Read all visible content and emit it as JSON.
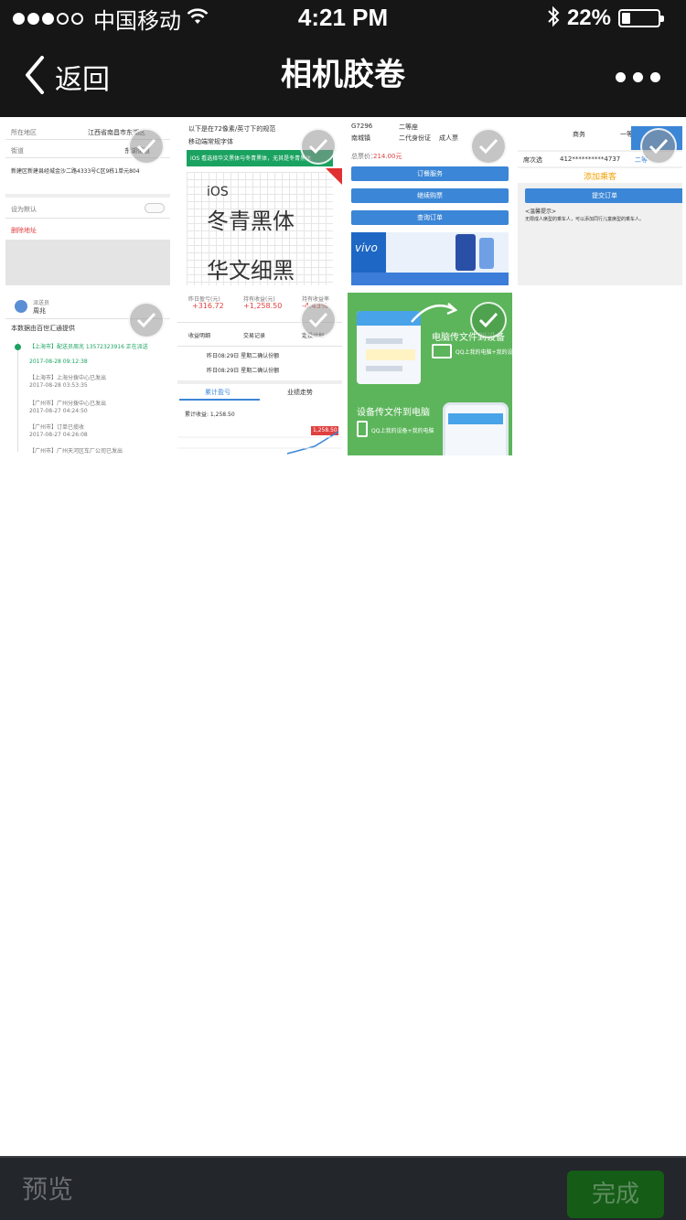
{
  "status_bar": {
    "carrier": "中国移动",
    "time": "4:21 PM",
    "battery": "22%",
    "battery_level": 0.22,
    "icons": [
      "signal-dots",
      "wifi-icon",
      "bluetooth-icon",
      "battery-icon"
    ]
  },
  "nav": {
    "back_label": "返回",
    "title": "相机胶卷",
    "more_icon": "more-dots-icon"
  },
  "photos": [
    {
      "lines": [
        "所在地区",
        "江西省南昌市东湖区",
        "街道",
        "东湖街道",
        "新建区新建县经城金沙二路4333号C区9栋1单元804",
        "设为默认",
        "删除地址"
      ]
    },
    {
      "lines": [
        "以下是在72像素/英寸下的规范",
        "移动端常规字体",
        "iOS 看选择华文黑体与冬青黑体，无其是冬青黑体",
        "iOS",
        "冬青黑体",
        "华文细黑"
      ]
    },
    {
      "lines": [
        "G7296",
        "二等座",
        "南城镇",
        "二代身份证",
        "成人票",
        "总票价：",
        "214.00元",
        "订餐服务",
        "继续购票",
        "查询订单",
        "vivo"
      ]
    },
    {
      "lines": [
        "商务",
        "一等",
        "席次选",
        "412**********4737",
        "二等",
        "添加乘客",
        "提交订单",
        "<温馨提示>",
        "无限成人席型的乘车人，可以添加同行儿童席型的乘车人。"
      ]
    },
    {
      "lines": [
        "派送员",
        "周兆",
        "本数据由百世汇通提供",
        "【上海市】配送员周兆 13572323916 正在派送",
        "2017-08-28 09:12:38",
        "【上海市】上海分拨中心已发出",
        "2017-08-28 03:53:35",
        "【广州市】广州分拨中心已发出",
        "2017-08-27 04:24:50",
        "【广州市】订单已揽收",
        "2017-08-27 04:26:08",
        "【广州市】广州天河区车厂公司已发出"
      ]
    },
    {
      "lines": [
        "昨日盈亏(元)",
        "+316.72",
        "持有收益(元)",
        "+1,258.50",
        "持有收益率",
        "-4.43%",
        "收益明细",
        "交易记录",
        "定投计划",
        "昨日08:29日 星期二确认份额",
        "累计盈亏",
        "业绩走势",
        "累计收益: 1,258.50",
        "1,258.50"
      ]
    },
    {
      "lines": [
        "电脑传文件到设备",
        "QQ上我的电脑+我的设备",
        "设备传文件到电脑",
        "QQ上我的设备+我的电脑"
      ]
    }
  ],
  "toolbar": {
    "preview_label": "预览",
    "done_label": "完成"
  },
  "colors": {
    "bar_bg": "#161616",
    "toolbar_bg": "#23262b",
    "done_bg": "#155d17",
    "done_text": "#5f8c5f",
    "accent_blue": "#3b86d6",
    "promo_green": "#5cb55a"
  }
}
